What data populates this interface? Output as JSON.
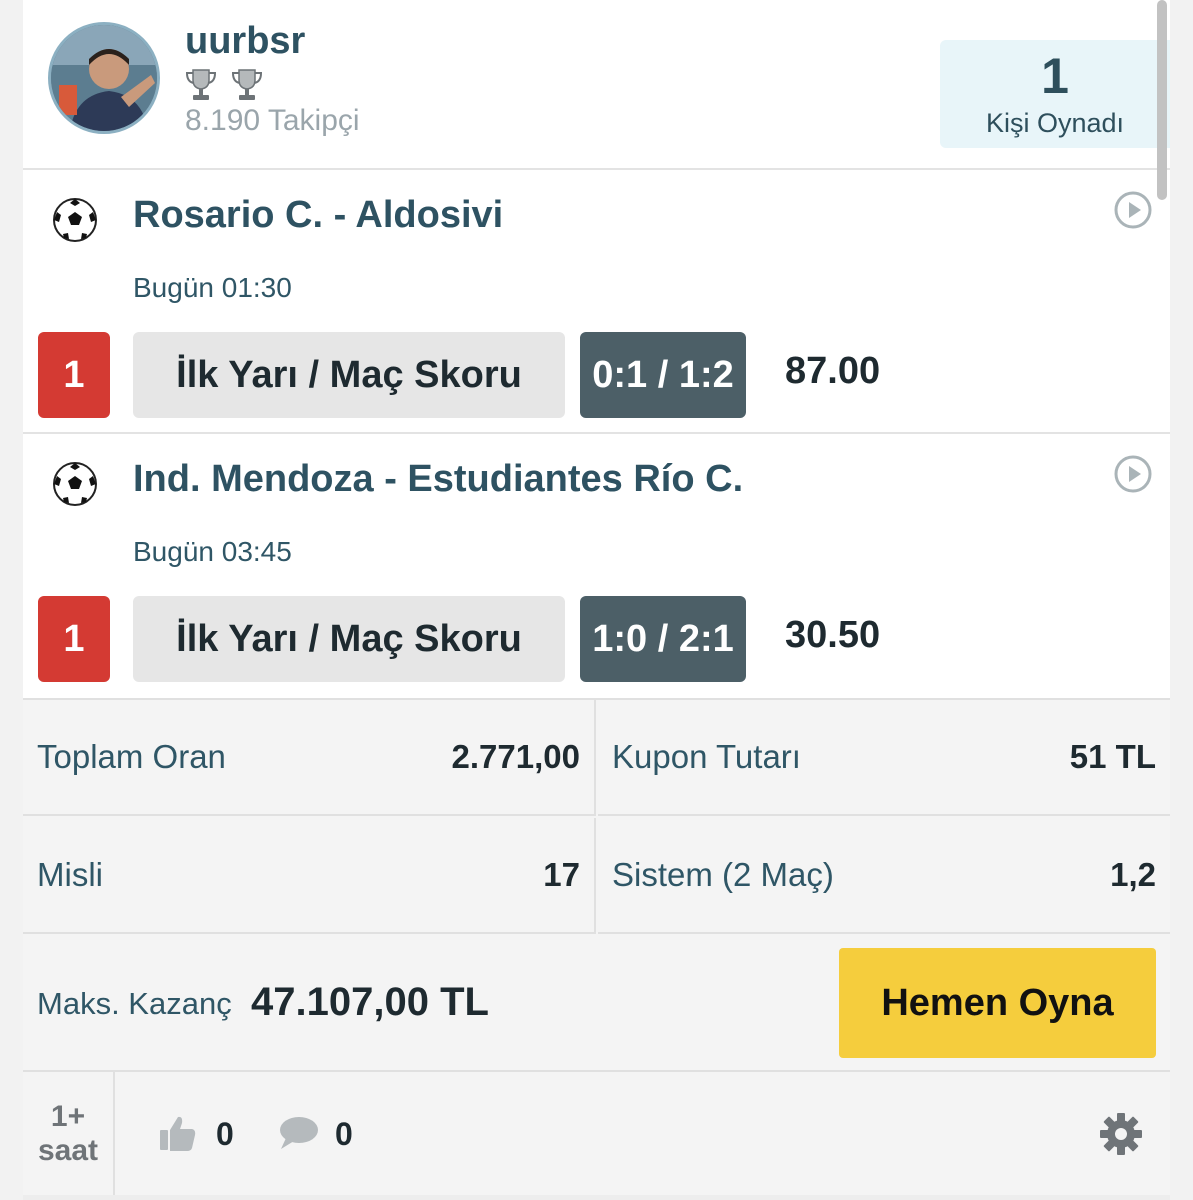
{
  "header": {
    "username": "uurbsr",
    "followers": "8.190 Takipçi",
    "players_count": "1",
    "players_label": "Kişi Oynadı"
  },
  "matches": [
    {
      "title": "Rosario C. - Aldosivi",
      "time": "Bugün 01:30",
      "pick": "1",
      "market": "İlk Yarı / Maç Skoru",
      "selection": "0:1 / 1:2",
      "odds": "87.00"
    },
    {
      "title": "Ind. Mendoza - Estudiantes Río C.",
      "time": "Bugün 03:45",
      "pick": "1",
      "market": "İlk Yarı / Maç Skoru",
      "selection": "1:0 / 2:1",
      "odds": "30.50"
    }
  ],
  "summary": {
    "total_odds_label": "Toplam Oran",
    "total_odds_value": "2.771,00",
    "coupon_amount_label": "Kupon Tutarı",
    "coupon_amount_value": "51 TL",
    "multiplier_label": "Misli",
    "multiplier_value": "17",
    "system_label": "Sistem (2 Maç)",
    "system_value": "1,2",
    "max_win_label": "Maks. Kazanç",
    "max_win_value": "47.107,00 TL",
    "play_button": "Hemen Oyna"
  },
  "footer": {
    "time_ago_line1": "1+",
    "time_ago_line2": "saat",
    "likes": "0",
    "comments": "0"
  },
  "colors": {
    "accent_yellow": "#f5cd3d",
    "pick_red": "#d43a33",
    "selection_slate": "#4c5f67",
    "title_teal": "#2e5262",
    "players_box_bg": "#e8f5f9"
  },
  "icons": [
    "trophy-icon",
    "soccer-ball-icon",
    "play-circle-icon",
    "thumbs-up-icon",
    "comment-icon",
    "gear-icon"
  ]
}
